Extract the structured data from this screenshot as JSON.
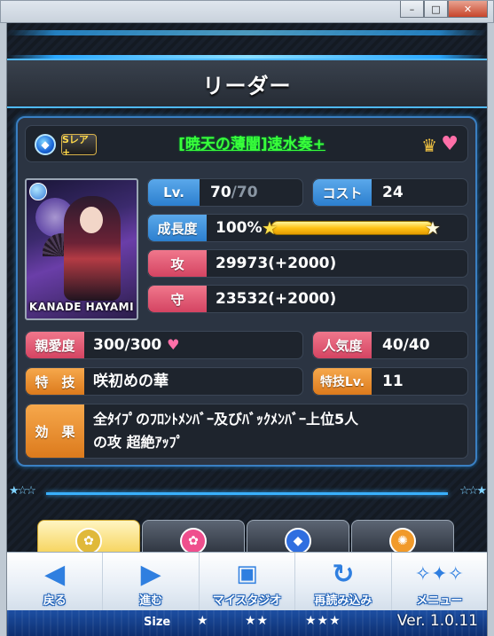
{
  "window": {
    "minimize": "–",
    "maximize": "□",
    "close": "✕"
  },
  "header": {
    "title": "リーダー"
  },
  "card": {
    "attribute_icon": "diamond-icon",
    "rarity": "Sレア+",
    "name": "[暁天の薄闇]速水奏+",
    "portrait_caption": "KANADE HAYAMI"
  },
  "stats": {
    "level_label": "Lv.",
    "level": "70",
    "level_max": "/70",
    "cost_label": "コスト",
    "cost": "24",
    "growth_label": "成長度",
    "growth": "100%",
    "growth_fraction": 1.0,
    "attack_label": "攻",
    "attack": "29973(+2000)",
    "defense_label": "守",
    "defense": "23532(+2000)",
    "affection_label": "親愛度",
    "affection": "300/300",
    "popularity_label": "人気度",
    "popularity": "40/40",
    "skill_label": "特　技",
    "skill": "咲初めの華",
    "skill_lv_label": "特技Lv.",
    "skill_lv": "11",
    "effect_label": "効　果",
    "effect_line1": "全ﾀｲﾌﾟのﾌﾛﾝﾄﾒﾝﾊﾞｰ及びﾊﾞｯｸﾒﾝﾊﾞｰ上位5人",
    "effect_line2": "の攻 超絶ｱｯﾌﾟ"
  },
  "nav": [
    {
      "label": "戻る",
      "icon": "arrow-left-icon"
    },
    {
      "label": "進む",
      "icon": "arrow-right-icon"
    },
    {
      "label": "マイスタジオ",
      "icon": "speaker-icon"
    },
    {
      "label": "再読み込み",
      "icon": "reload-icon"
    },
    {
      "label": "メニュー",
      "icon": "menu-logo-icon"
    }
  ],
  "footer": {
    "size_label": "Size",
    "size_options": [
      "★",
      "★★",
      "★★★"
    ],
    "version": "Ver. 1.0.11"
  },
  "colors": {
    "accent_blue": "#3a7fc2",
    "name_green": "#39ff3a",
    "tag_blue": "#2c7fcf",
    "tag_red": "#d44462",
    "tag_orange": "#dc7a1c"
  }
}
